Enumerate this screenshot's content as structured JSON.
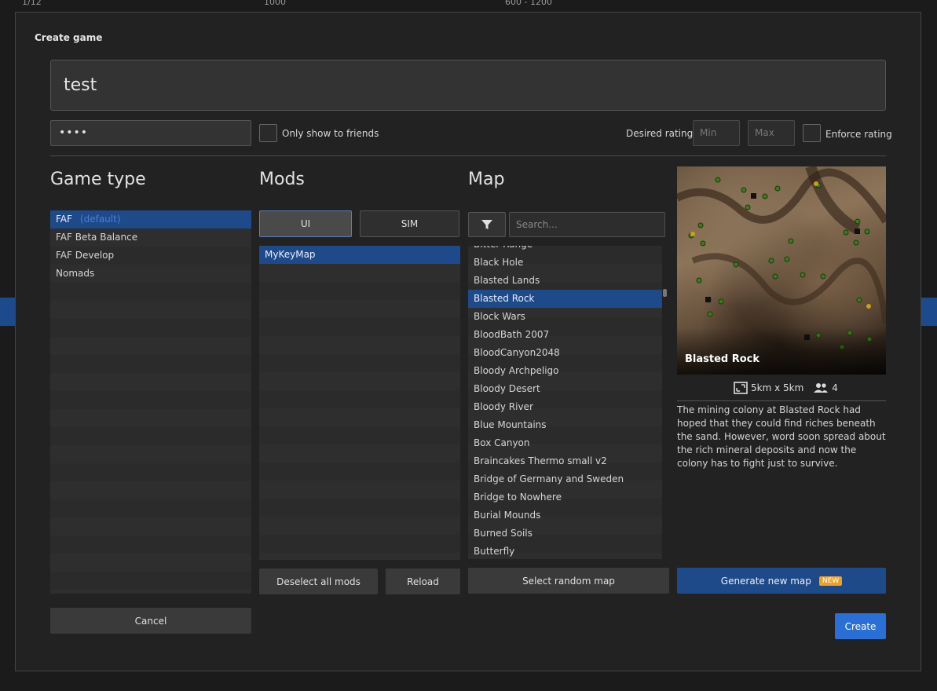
{
  "background_header": {
    "col1": "1/12",
    "col2": "1000",
    "col3": "600 - 1200"
  },
  "dialog": {
    "title": "Create game",
    "game_name": "test",
    "password": "••••",
    "only_friends_label": "Only show to friends",
    "desired_rating_label": "Desired rating",
    "min_placeholder": "Min",
    "max_placeholder": "Max",
    "enforce_rating_label": "Enforce rating"
  },
  "game_type": {
    "title": "Game type",
    "items": [
      {
        "label": "FAF",
        "tag": "(default)"
      },
      {
        "label": "FAF Beta Balance"
      },
      {
        "label": "FAF Develop"
      },
      {
        "label": "Nomads"
      }
    ]
  },
  "mods": {
    "title": "Mods",
    "tab_ui": "UI",
    "tab_sim": "SIM",
    "items": [
      "MyKeyMap"
    ],
    "deselect_label": "Deselect all mods",
    "reload_label": "Reload"
  },
  "map": {
    "title": "Map",
    "search_placeholder": "Search...",
    "items": [
      "Bitter Range",
      "Black Hole",
      "Blasted Lands",
      "Blasted Rock",
      "Block Wars",
      "BloodBath 2007",
      "BloodCanyon2048",
      "Bloody Archpeligo",
      "Bloody Desert",
      "Bloody River",
      "Blue Mountains",
      "Box Canyon",
      "Braincakes Thermo small v2",
      "Bridge of Germany and Sweden",
      "Bridge to Nowhere",
      "Burial Mounds",
      "Burned Soils",
      "Butterfly"
    ],
    "random_label": "Select random map"
  },
  "preview": {
    "name": "Blasted Rock",
    "size": "5km x 5km",
    "players": "4",
    "description": "The mining colony at Blasted Rock had hoped that they could find riches beneath the sand. However, word soon spread about the rich mineral deposits and now the colony has to fight just to survive.",
    "generate_label": "Generate new map",
    "new_badge": "NEW"
  },
  "actions": {
    "cancel_label": "Cancel",
    "create_label": "Create"
  },
  "colors": {
    "accent": "#2a6fd6",
    "selected": "#1f4a8a",
    "badge": "#f0a020"
  }
}
